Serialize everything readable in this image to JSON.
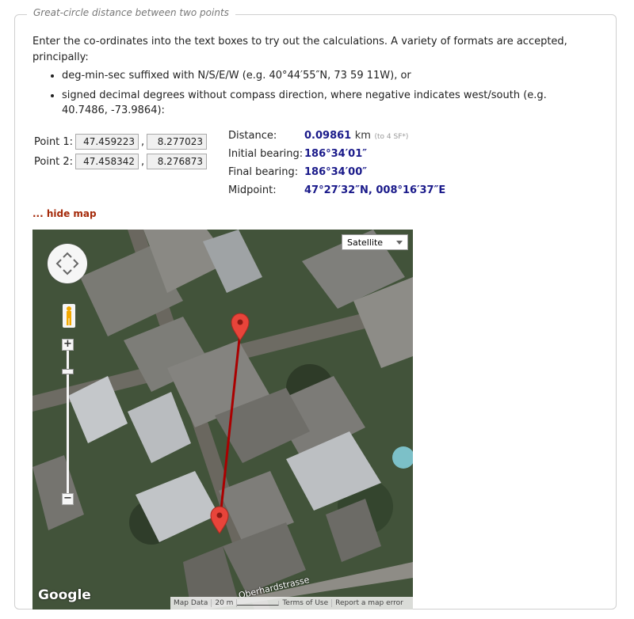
{
  "legend": "Great-circle distance between two points",
  "intro": "Enter the co-ordinates into the text boxes to try out the calculations. A variety of formats are accepted, principally:",
  "formats": [
    "deg-min-sec suffixed with N/S/E/W (e.g. 40°44′55″N, 73 59 11W), or",
    "signed decimal degrees without compass direction, where negative indicates west/south (e.g. 40.7486, -73.9864):"
  ],
  "point1": {
    "label": "Point 1:",
    "lat": "47.459223",
    "lon": "8.277023"
  },
  "point2": {
    "label": "Point 2:",
    "lat": "47.458342",
    "lon": "8.276873"
  },
  "comma": ",",
  "results": {
    "distance_label": "Distance:",
    "distance_value": "0.09861",
    "distance_unit": "km",
    "distance_note": "(to 4 SF*)",
    "initial_bearing_label": "Initial bearing:",
    "initial_bearing_value": "186°34′01″",
    "final_bearing_label": "Final bearing:",
    "final_bearing_value": "186°34′00″",
    "midpoint_label": "Midpoint:",
    "midpoint_value": "47°27′32″N, 008°16′37″E"
  },
  "hide_map": "... hide map",
  "map": {
    "type_selected": "Satellite",
    "google_logo": "Google",
    "street_label": "Oberhardstrasse",
    "zoom_in": "+",
    "zoom_out": "−",
    "attribution": {
      "map_data": "Map Data",
      "scale": "20 m",
      "terms": "Terms of Use",
      "report": "Report a map error"
    },
    "marker_color": "#e8443a",
    "line_color": "#aa0000"
  }
}
